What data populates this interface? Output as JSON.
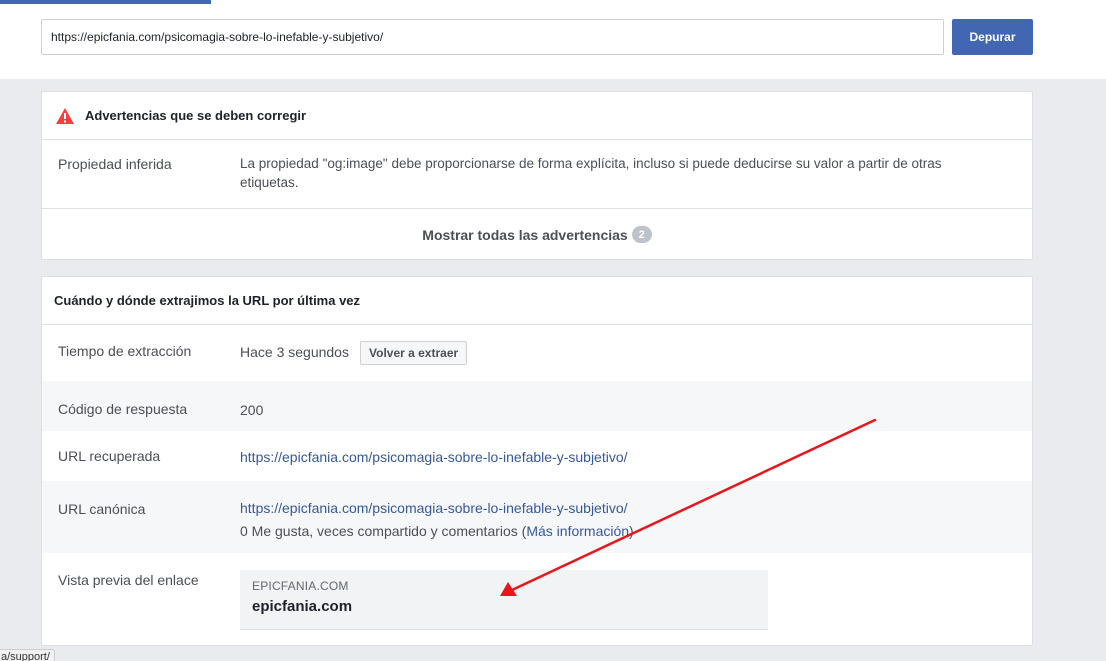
{
  "toolbar": {
    "url_value": "https://epicfania.com/psicomagia-sobre-lo-inefable-y-subjetivo/",
    "debug_label": "Depurar"
  },
  "warnings": {
    "title": "Advertencias que se deben corregir",
    "row_label": "Propiedad inferida",
    "row_text": "La propiedad \"og:image\" debe proporcionarse de forma explícita, incluso si puede deducirse su valor a partir de otras etiquetas.",
    "show_all_label": "Mostrar todas las advertencias",
    "count": "2"
  },
  "scrape": {
    "title": "Cuándo y dónde extrajimos la URL por última vez",
    "fetch_time_label": "Tiempo de extracción",
    "fetch_time_value": "Hace 3 segundos",
    "refetch_label": "Volver a extraer",
    "response_code_label": "Código de respuesta",
    "response_code_value": "200",
    "fetched_url_label": "URL recuperada",
    "fetched_url_value": "https://epicfania.com/psicomagia-sobre-lo-inefable-y-subjetivo/",
    "canonical_url_label": "URL canónica",
    "canonical_url_value": "https://epicfania.com/psicomagia-sobre-lo-inefable-y-subjetivo/",
    "engagement_prefix": "0 Me gusta, veces compartido y comentarios (",
    "more_info_label": "Más información",
    "engagement_suffix": ")",
    "preview_label": "Vista previa del enlace",
    "preview_domain": "EPICFANIA.COM",
    "preview_title": "epicfania.com"
  },
  "status_tip": "a/support/",
  "colors": {
    "brand": "#4267b2",
    "link": "#365899",
    "warning": "#fa3e3e",
    "annotation_arrow": "#e8151b"
  }
}
